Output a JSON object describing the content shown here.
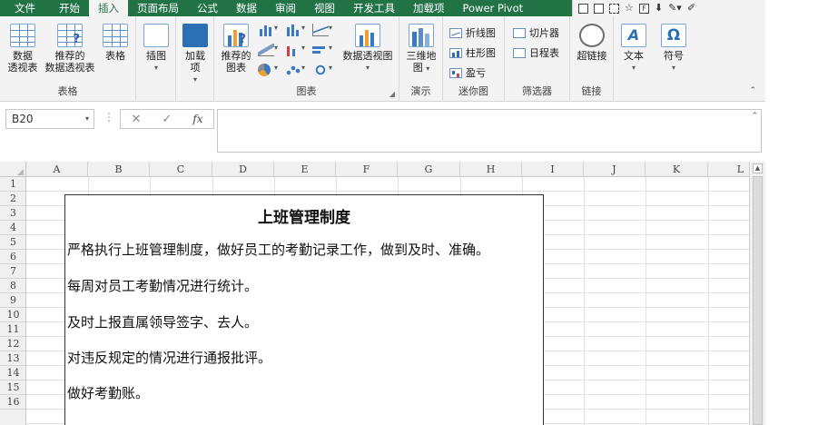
{
  "ribbon_tabs": [
    "文件",
    "开始",
    "插入",
    "页面布局",
    "公式",
    "数据",
    "审阅",
    "视图",
    "开发工具",
    "加载项",
    "Power Pivot"
  ],
  "active_tab_index": 2,
  "quick_access": {
    "icons": [
      "checkbox-icon",
      "checkbox-icon",
      "checkbox-icon",
      "star-icon",
      "form-icon",
      "save-icon",
      "paint-icon",
      "pen-icon"
    ],
    "form_letter": "F"
  },
  "ribbon": {
    "tables": {
      "label": "表格",
      "pivot_table": [
        "数据",
        "透视表"
      ],
      "recommended_pivot": [
        "推荐的",
        "数据透视表"
      ],
      "table": "表格"
    },
    "illustrations": {
      "label": "插图",
      "caret": "▾"
    },
    "addins": {
      "label": [
        "加载",
        "项"
      ],
      "caret": "▾"
    },
    "charts": {
      "label": "图表",
      "recommended": [
        "推荐的",
        "图表"
      ],
      "pivot_chart": "数据透视图",
      "caret": "▾",
      "launcher": "◢"
    },
    "tours": {
      "label": "演示",
      "map3d": [
        "三维地",
        "图"
      ],
      "caret": "▾"
    },
    "sparklines": {
      "label": "迷你图",
      "line": "折线图",
      "column": "柱形图",
      "winloss": "盈亏"
    },
    "filters": {
      "label": "筛选器",
      "slicer": "切片器",
      "timeline": "日程表"
    },
    "links": {
      "label": "链接",
      "hyperlink": "超链接"
    },
    "text": {
      "label": "文本",
      "caret": "▾",
      "icon_glyph": "A"
    },
    "symbols": {
      "label": "符号",
      "caret": "▾",
      "icon_glyph": "Ω"
    },
    "collapse_glyph": "⌃"
  },
  "formula_bar": {
    "name_box": "B20",
    "name_box_caret": "▾",
    "separator": "⋮",
    "cancel": "✕",
    "enter": "✓",
    "fx": "fx",
    "value": "",
    "expand_glyph": "⌃"
  },
  "columns": [
    "A",
    "B",
    "C",
    "D",
    "E",
    "F",
    "G",
    "H",
    "I",
    "J",
    "K",
    "L"
  ],
  "rows": [
    "1",
    "2",
    "3",
    "4",
    "5",
    "6",
    "7",
    "8",
    "9",
    "10",
    "11",
    "12",
    "13",
    "14",
    "15",
    "16"
  ],
  "scroll_up_glyph": "▲",
  "document": {
    "title": "上班管理制度",
    "lines": [
      "严格执行上班管理制度，做好员工的考勤记录工作，做到及时、准确。",
      "每周对员工考勤情况进行统计。",
      "及时上报直属领导签字、去人。",
      "对违反规定的情况进行通报批评。",
      "做好考勤账。"
    ]
  }
}
